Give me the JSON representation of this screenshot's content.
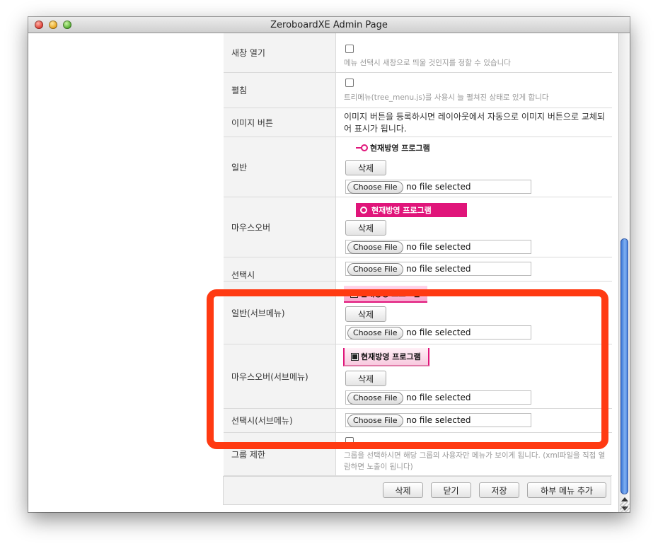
{
  "window": {
    "title": "ZeroboardXE Admin Page"
  },
  "rows": {
    "new_window": {
      "label": "새창 열기",
      "note": "메뉴 선택시 새창으로 띄울 것인지를 정할 수 있습니다"
    },
    "expand": {
      "label": "펼침",
      "note": "트리메뉴(tree_menu.js)를 사용시 늘 펼쳐진 상태로 있게 합니다"
    },
    "image_button": {
      "label": "이미지 버튼",
      "desc": "이미지 버튼을 등록하시면 레이아웃에서 자동으로 이미지 버튼으로 교체되어 표시가 됩니다."
    },
    "normal": {
      "label": "일반"
    },
    "mouseover": {
      "label": "마우스오버"
    },
    "selected": {
      "label": "선택시"
    },
    "sub_normal": {
      "label": "일반(서브메뉴)"
    },
    "sub_mouseover": {
      "label": "마우스오버(서브메뉴)"
    },
    "sub_selected": {
      "label": "선택시(서브메뉴)"
    },
    "group_limit": {
      "label": "그룹 제한",
      "note": "그룹을 선택하시면 해당 그룹의 사용자만 메뉴가 보이게 됩니다. (xml파일을 직접 열람하면 노출이 됩니다)"
    }
  },
  "preview_text": "현재방영 프로그램",
  "delete_label": "삭제",
  "file_input": {
    "button": "Choose File",
    "status": "no file selected"
  },
  "footer": {
    "delete": "삭제",
    "close": "닫기",
    "save": "저장",
    "add_submenu": "하부 메뉴 추가"
  },
  "colors": {
    "accent": "#e0157a",
    "highlight": "#ff3a12"
  }
}
